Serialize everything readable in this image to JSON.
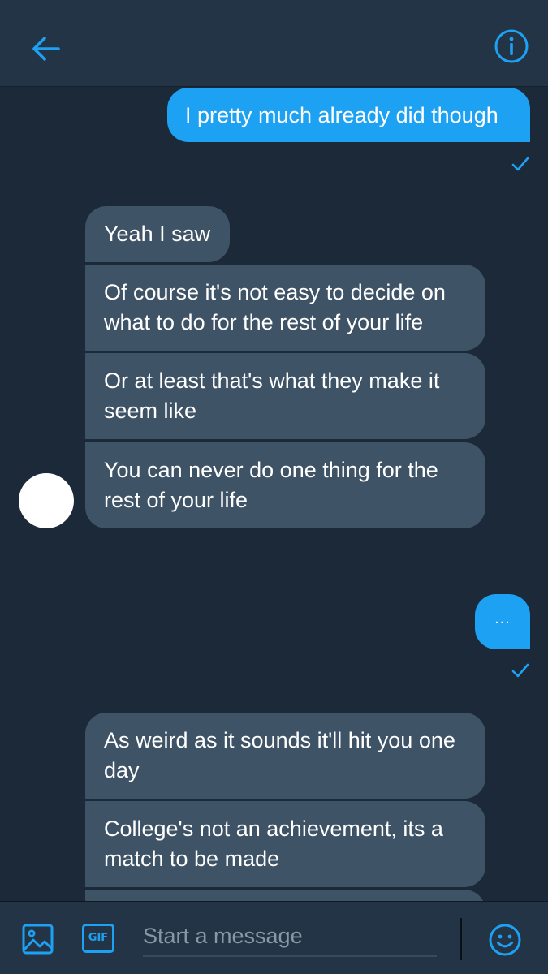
{
  "header": {
    "back_icon": "arrow-left-icon",
    "info_icon": "info-icon",
    "accent": "#1da1f2"
  },
  "messages": [
    {
      "direction": "out",
      "text": "I pretty much already did though",
      "status_icon": "check-icon"
    },
    {
      "direction": "in",
      "text": "Yeah I saw"
    },
    {
      "direction": "in",
      "text": "Of course it's not easy to decide on what to do for the rest of your life"
    },
    {
      "direction": "in",
      "text": "Or at least that's what they make it seem like"
    },
    {
      "direction": "in",
      "text": "You can never do one thing for the rest of your life"
    },
    {
      "direction": "out",
      "text": "...",
      "status_icon": "check-icon"
    },
    {
      "direction": "in",
      "text": "As weird as it sounds it'll hit you one day"
    },
    {
      "direction": "in",
      "text": "College's not an achievement, its a match to be made"
    }
  ],
  "composer": {
    "placeholder": "Start a message",
    "gif_label": "GIF",
    "media_icon": "image-icon",
    "emoji_icon": "smiley-icon"
  },
  "colors": {
    "background": "#1c2938",
    "header": "#243447",
    "incoming_bubble": "#3f5366",
    "outgoing_bubble": "#1da1f2"
  }
}
